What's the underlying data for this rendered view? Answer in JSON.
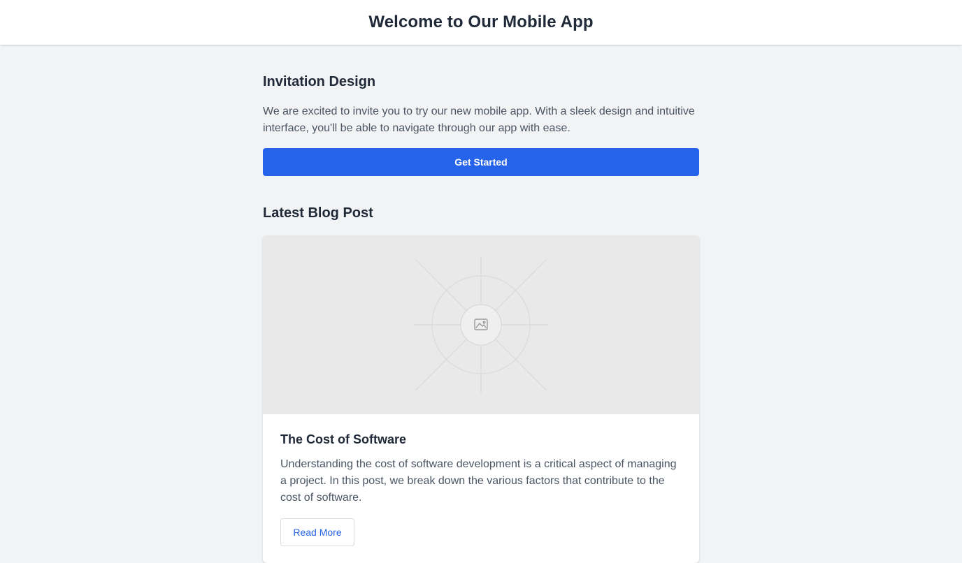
{
  "header": {
    "title": "Welcome to Our Mobile App"
  },
  "invitation": {
    "title": "Invitation Design",
    "text": "We are excited to invite you to try our new mobile app. With a sleek design and intuitive interface, you'll be able to navigate through our app with ease.",
    "button_label": "Get Started"
  },
  "blog": {
    "section_title": "Latest Blog Post",
    "post": {
      "image_icon": "image-placeholder-icon",
      "title": "The Cost of Software",
      "excerpt": "Understanding the cost of software development is a critical aspect of managing a project. In this post, we break down the various factors that contribute to the cost of software.",
      "button_label": "Read More"
    }
  },
  "colors": {
    "accent": "#2563eb",
    "page_background": "#f2f3f5",
    "heading_text": "#1f2937",
    "body_text": "#4b5563"
  }
}
